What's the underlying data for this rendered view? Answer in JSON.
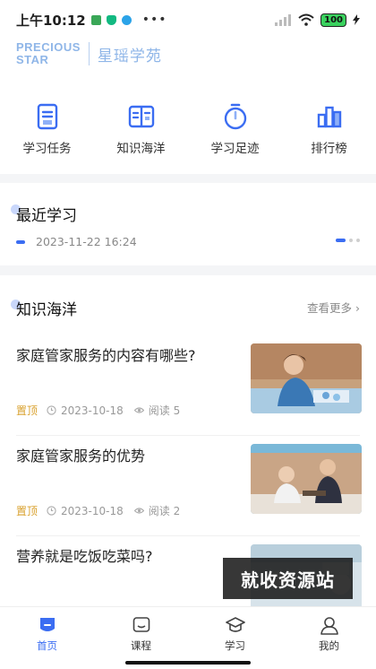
{
  "status_bar": {
    "time": "上午10:12",
    "battery": "100"
  },
  "brand": {
    "en_line1": "PRECIOUS",
    "en_line2": "STAR",
    "cn": "星瑶学苑"
  },
  "quick_nav": [
    {
      "label": "学习任务",
      "icon": "task-doc-icon"
    },
    {
      "label": "知识海洋",
      "icon": "open-book-icon"
    },
    {
      "label": "学习足迹",
      "icon": "stopwatch-icon"
    },
    {
      "label": "排行榜",
      "icon": "bar-chart-icon"
    }
  ],
  "recent": {
    "title": "最近学习",
    "date": "2023-11-22 16:24"
  },
  "ocean": {
    "title": "知识海洋",
    "more": "查看更多",
    "articles": [
      {
        "title": "家庭管家服务的内容有哪些?",
        "pin": "置顶",
        "date": "2023-10-18",
        "reads": "阅读 5"
      },
      {
        "title": "家庭管家服务的优势",
        "pin": "置顶",
        "date": "2023-10-18",
        "reads": "阅读 2"
      },
      {
        "title": "营养就是吃饭吃菜吗?"
      }
    ]
  },
  "watermark": "就收资源站",
  "tabs": [
    {
      "label": "首页",
      "icon": "home-icon",
      "active": true
    },
    {
      "label": "课程",
      "icon": "course-icon"
    },
    {
      "label": "学习",
      "icon": "graduation-cap-icon"
    },
    {
      "label": "我的",
      "icon": "user-icon"
    }
  ],
  "colors": {
    "accent": "#3b6df2",
    "pin": "#d9a12e",
    "brand": "#8fb6e8"
  }
}
